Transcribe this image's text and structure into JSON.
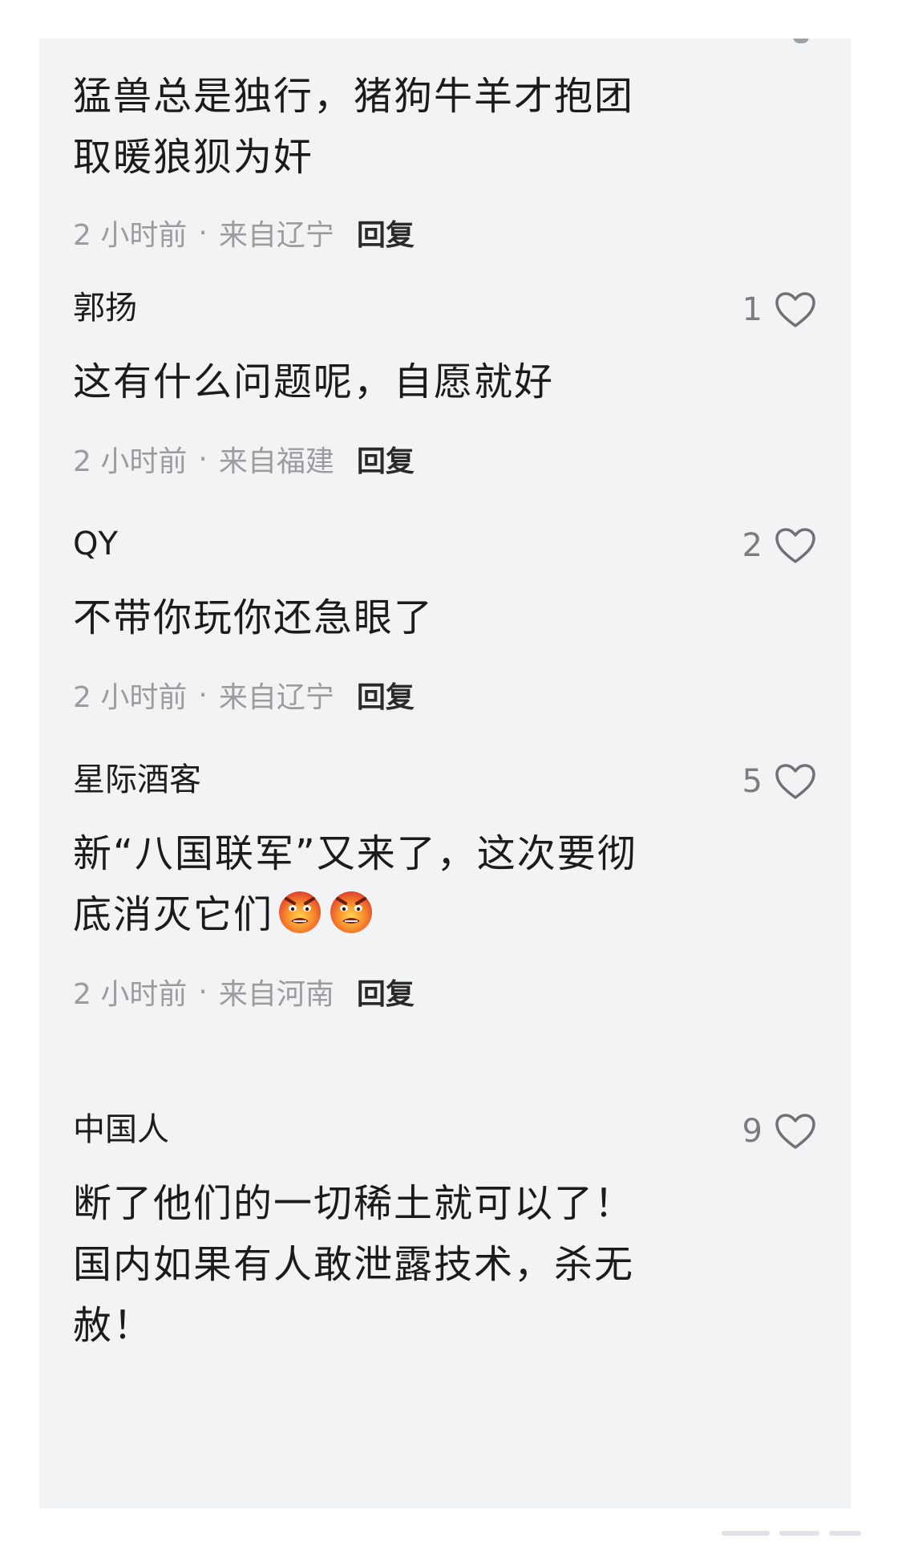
{
  "comments": [
    {
      "username": "",
      "likes": "",
      "content": "猛兽总是独行，猪狗牛羊才抱团取暖狼狈为奸",
      "time": "2 小时前",
      "location": "来自辽宁",
      "reply_label": "回复"
    },
    {
      "username": "郭扬",
      "likes": "1",
      "content": "这有什么问题呢，自愿就好",
      "time": "2 小时前",
      "location": "来自福建",
      "reply_label": "回复"
    },
    {
      "username": "QY",
      "likes": "2",
      "content": "不带你玩你还急眼了",
      "time": "2 小时前",
      "location": "来自辽宁",
      "reply_label": "回复"
    },
    {
      "username": "星际酒客",
      "likes": "5",
      "content": "新“八国联军”又来了，这次要彻底消灭它们",
      "emojis": [
        "angry-face-icon",
        "angry-face-icon"
      ],
      "time": "2 小时前",
      "location": "来自河南",
      "reply_label": "回复"
    },
    {
      "username": "中国人",
      "likes": "9",
      "content": "断了他们的一切稀土就可以了！国内如果有人敢泄露技术，杀无赦！",
      "time": "",
      "location": "",
      "reply_label": ""
    }
  ],
  "separator": "·",
  "colors": {
    "panel": "#f2f3f5",
    "text": "#1b1b1d",
    "meta": "#9a9ca0",
    "emoji_fire": "#f07a2e"
  }
}
